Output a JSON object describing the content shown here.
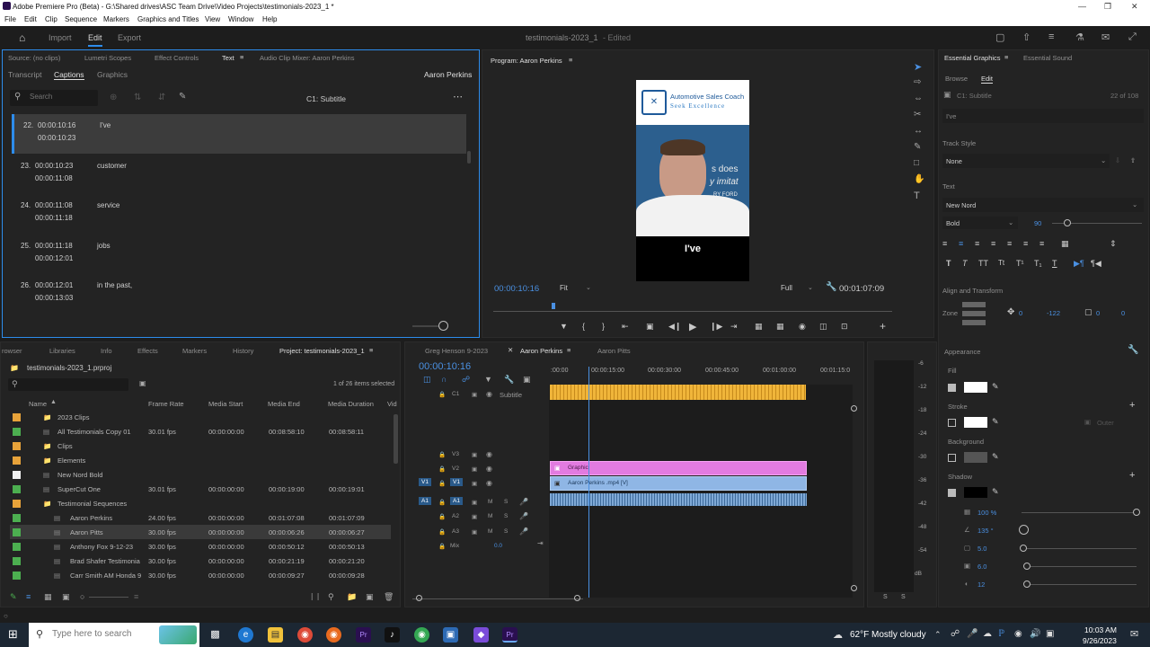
{
  "window": {
    "title": "Adobe Premiere Pro (Beta) - G:\\Shared drives\\ASC Team Drive\\Video Projects\\testimonials-2023_1 *"
  },
  "menu": [
    "File",
    "Edit",
    "Clip",
    "Sequence",
    "Markers",
    "Graphics and Titles",
    "View",
    "Window",
    "Help"
  ],
  "workspace": {
    "tabs": [
      "Import",
      "Edit",
      "Export"
    ],
    "project_name": "testimonials-2023_1",
    "status": "- Edited"
  },
  "source_panel": {
    "tabs": [
      "Source: (no clips)",
      "Lumetri Scopes",
      "Effect Controls",
      "Text",
      "Audio Clip Mixer: Aaron Perkins"
    ],
    "subtabs": [
      "Transcript",
      "Captions",
      "Graphics"
    ],
    "sequence_name": "Aaron Perkins",
    "search_placeholder": "Search",
    "track_label": "C1: Subtitle",
    "captions": [
      {
        "num": "22.",
        "in": "00:00:10:16",
        "out": "00:00:10:23",
        "text": "I've"
      },
      {
        "num": "23.",
        "in": "00:00:10:23",
        "out": "00:00:11:08",
        "text": "customer"
      },
      {
        "num": "24.",
        "in": "00:00:11:08",
        "out": "00:00:11:18",
        "text": "service"
      },
      {
        "num": "25.",
        "in": "00:00:11:18",
        "out": "00:00:12:01",
        "text": "jobs"
      },
      {
        "num": "26.",
        "in": "00:00:12:01",
        "out": "00:00:13:03",
        "text": "in the past,"
      }
    ]
  },
  "program_monitor": {
    "title": "Program: Aaron Perkins",
    "timecode": "00:00:10:16",
    "fit": "Fit",
    "quality": "Full",
    "duration": "00:01:07:09",
    "logo_line1": "Automotive Sales Coach",
    "logo_line2": "Seek Excellence",
    "video_text_1": "s does",
    "video_text_2": "y imitat",
    "video_text_3": "RY FORD",
    "caption": "I've"
  },
  "project_panel": {
    "tabs": [
      "rowser",
      "Libraries",
      "Info",
      "Effects",
      "Markers",
      "History",
      "Project: testimonials-2023_1"
    ],
    "file": "testimonials-2023_1.prproj",
    "selection": "1 of 26 items selected",
    "columns": [
      "Name",
      "Frame Rate",
      "Media Start",
      "Media End",
      "Media Duration",
      "Vid"
    ],
    "items": [
      {
        "name": "2023 Clips",
        "fps": "",
        "start": "",
        "end": "",
        "dur": "",
        "color": "#e8a33a",
        "indent": 1
      },
      {
        "name": "All Testimonials Copy 01",
        "fps": "30.01 fps",
        "start": "00:00:00:00",
        "end": "00:08:58:10",
        "dur": "00:08:58:11",
        "color": "#4caf50",
        "indent": 1
      },
      {
        "name": "Clips",
        "fps": "",
        "start": "",
        "end": "",
        "dur": "",
        "color": "#e8a33a",
        "indent": 1
      },
      {
        "name": "Elements",
        "fps": "",
        "start": "",
        "end": "",
        "dur": "",
        "color": "#e8a33a",
        "indent": 1
      },
      {
        "name": "New Nord Bold",
        "fps": "",
        "start": "",
        "end": "",
        "dur": "",
        "color": "#f0f0f0",
        "indent": 1
      },
      {
        "name": "SuperCut One",
        "fps": "30.01 fps",
        "start": "00:00:00:00",
        "end": "00:00:19:00",
        "dur": "00:00:19:01",
        "color": "#4caf50",
        "indent": 1
      },
      {
        "name": "Testimonial Sequences",
        "fps": "",
        "start": "",
        "end": "",
        "dur": "",
        "color": "#e8a33a",
        "indent": 1
      },
      {
        "name": "Aaron Perkins",
        "fps": "24.00 fps",
        "start": "00:00:00:00",
        "end": "00:01:07:08",
        "dur": "00:01:07:09",
        "color": "#4caf50",
        "indent": 2
      },
      {
        "name": "Aaron Pitts",
        "fps": "30.00 fps",
        "start": "00:00:00:00",
        "end": "00:00:06:26",
        "dur": "00:00:06:27",
        "color": "#4caf50",
        "indent": 2
      },
      {
        "name": "Anthony Fox 9-12-23",
        "fps": "30.00 fps",
        "start": "00:00:00:00",
        "end": "00:00:50:12",
        "dur": "00:00:50:13",
        "color": "#4caf50",
        "indent": 2
      },
      {
        "name": "Brad Shafer Testimonia",
        "fps": "30.00 fps",
        "start": "00:00:00:00",
        "end": "00:00:21:19",
        "dur": "00:00:21:20",
        "color": "#4caf50",
        "indent": 2
      },
      {
        "name": "Carr Smith AM Honda 9",
        "fps": "30.00 fps",
        "start": "00:00:00:00",
        "end": "00:00:09:27",
        "dur": "00:00:09:28",
        "color": "#4caf50",
        "indent": 2
      }
    ]
  },
  "timeline": {
    "tabs": [
      "Greg Henson 9-2023",
      "Aaron Perkins",
      "Aaron Pitts"
    ],
    "timecode": "00:00:10:16",
    "ruler": [
      ":00:00",
      "00:00:15:00",
      "00:00:30:00",
      "00:00:45:00",
      "00:01:00:00",
      "00:01:15:0"
    ],
    "tracks": [
      "Subtitle",
      "V3",
      "V2",
      "V1",
      "A1",
      "A2",
      "A3",
      "Mix"
    ],
    "clip_graphic": "Graphic",
    "clip_video": "Aaron Perkins .mp4 [V]",
    "mix_value": "0.0"
  },
  "audio_meter": {
    "scale": [
      "-6",
      "-12",
      "-18",
      "-24",
      "-30",
      "-36",
      "-42",
      "-48",
      "-54",
      "dB"
    ],
    "solo": [
      "S",
      "S"
    ]
  },
  "essential_graphics": {
    "tabs": [
      "Essential Graphics",
      "Essential Sound"
    ],
    "subtabs": [
      "Browse",
      "Edit"
    ],
    "layer": "C1: Subtitle",
    "count": "22 of 108",
    "text_value": "I've",
    "track_style_label": "Track Style",
    "track_style": "None",
    "text_label": "Text",
    "font": "New Nord",
    "weight": "Bold",
    "size": "90",
    "align_label": "Align and Transform",
    "zone_label": "Zone",
    "pos_x": "0",
    "pos_y": "-122",
    "scale_a": "0",
    "scale_b": "0",
    "appearance_label": "Appearance",
    "fill_label": "Fill",
    "stroke_label": "Stroke",
    "stroke_mode": "Outer",
    "background_label": "Background",
    "shadow_label": "Shadow",
    "shadow_opacity": "100 %",
    "shadow_angle": "135 °",
    "shadow_distance": "5.0",
    "shadow_size": "6.0",
    "shadow_blur": "12"
  },
  "taskbar": {
    "search_placeholder": "Type here to search",
    "weather": "62°F  Mostly cloudy",
    "time": "10:03 AM",
    "date": "9/26/2023"
  }
}
